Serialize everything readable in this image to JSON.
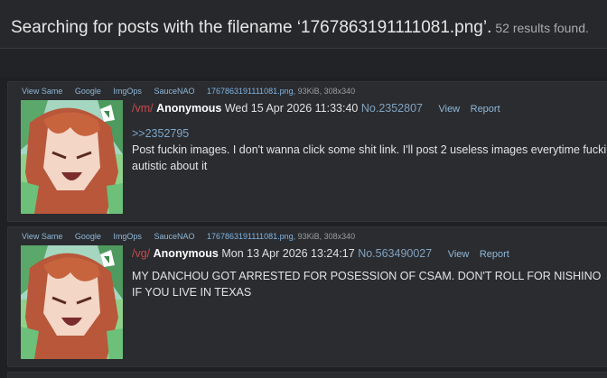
{
  "header": {
    "title": "Searching for posts with the filename ‘1767863191111081.png’.",
    "count": "52 results found."
  },
  "posts": [
    {
      "actions": [
        "View Same",
        "Google",
        "ImgOps",
        "SauceNAO"
      ],
      "filename": "1767863191111081.png",
      "filemeta": ", 93KiB, 308x340",
      "board": "/vm/",
      "name": "Anonymous",
      "date": "Wed 15 Apr 2026 11:33:40",
      "number": "No.2352807",
      "view": "View",
      "report": "Report",
      "quote": ">>2352795",
      "text": "Post fuckin images. I don't wanna click some shit link. I'll post 2 useless images everytime fucking autistic about it"
    },
    {
      "actions": [
        "View Same",
        "Google",
        "ImgOps",
        "SauceNAO"
      ],
      "filename": "1767863191111081.png",
      "filemeta": ", 93KiB, 308x340",
      "board": "/vg/",
      "name": "Anonymous",
      "date": "Mon 13 Apr 2026 13:24:17",
      "number": "No.563490027",
      "view": "View",
      "report": "Report",
      "text": "MY DANCHOU GOT ARRESTED FOR POSESSION OF CSAM. DON'T ROLL FOR NISHINO IF YOU LIVE IN TEXAS"
    }
  ]
}
